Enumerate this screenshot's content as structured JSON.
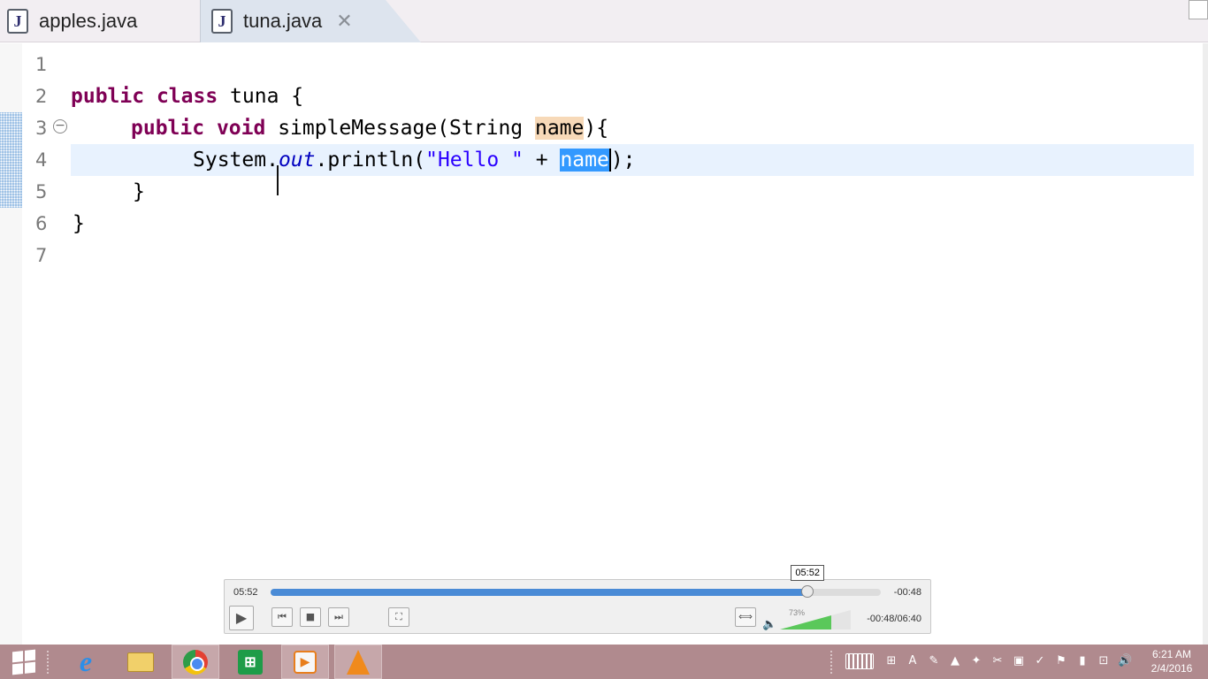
{
  "tabs": [
    {
      "label": "apples.java",
      "icon": "java-file-icon",
      "active": false
    },
    {
      "label": "tuna.java",
      "icon": "java-file-icon",
      "active": true
    }
  ],
  "editor": {
    "lines": [
      {
        "num": "1"
      },
      {
        "num": "2",
        "kw1": "public",
        "kw2": "class",
        "text": " tuna {"
      },
      {
        "num": "3",
        "kw1": "public",
        "kw2": "void",
        "method": " simpleMessage(String ",
        "param": "name",
        "tail": "){"
      },
      {
        "num": "4",
        "obj": "System.",
        "field": "out",
        "call": ".println(",
        "str": "\"Hello \"",
        "plus": " + ",
        "sel": "name",
        "end": ");"
      },
      {
        "num": "5",
        "text": "}"
      },
      {
        "num": "6",
        "text": "}"
      },
      {
        "num": "7"
      }
    ]
  },
  "player": {
    "elapsed": "05:52",
    "remaining": "-00:48",
    "tooltip": "05:52",
    "progress_fraction": 0.88,
    "volume_label": "73%",
    "volume_fraction": 0.73,
    "duration": "-00:48/06:40",
    "accent": "#4a8bd6"
  },
  "taskbar": {
    "time": "6:21 AM",
    "date": "2/4/2016",
    "color": "#b08a8e"
  }
}
